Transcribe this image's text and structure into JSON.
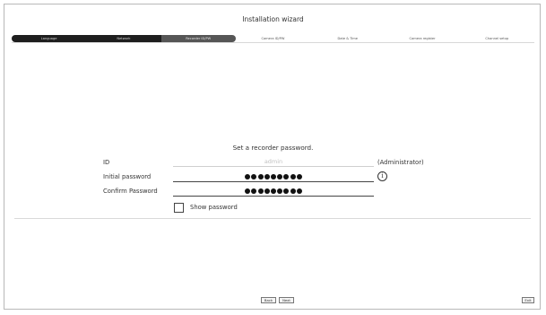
{
  "window": {
    "title": "Installation wizard"
  },
  "steps": [
    {
      "label": "Language",
      "state": "done"
    },
    {
      "label": "Network",
      "state": "done"
    },
    {
      "label": "Recorder ID/PW",
      "state": "current"
    },
    {
      "label": "Camera ID/PW",
      "state": "pending"
    },
    {
      "label": "Date & Time",
      "state": "pending"
    },
    {
      "label": "Camera register",
      "state": "pending"
    },
    {
      "label": "Channel setup",
      "state": "pending"
    }
  ],
  "form": {
    "prompt": "Set a recorder password.",
    "id_label": "ID",
    "id_value": "admin",
    "id_note": "(Administrator)",
    "initial_password_label": "Initial password",
    "confirm_password_label": "Confirm Password",
    "password_mask_length": 9,
    "info_icon_glyph": "i",
    "show_password_label": "Show password",
    "show_password_checked": false
  },
  "footer": {
    "back_label": "Back",
    "next_label": "Next",
    "exit_label": "Exit"
  },
  "colors": {
    "step_done": "#1e1e1e",
    "step_current": "#565656",
    "border": "#b8b8b8"
  }
}
